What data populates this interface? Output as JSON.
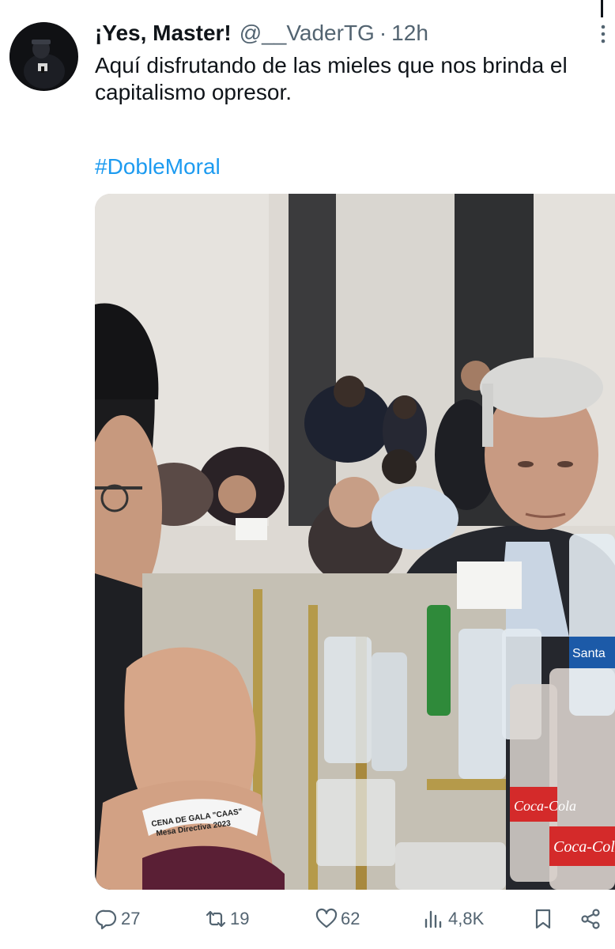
{
  "tweet": {
    "display_name": "¡Yes, Master!",
    "handle": "@__VaderTG",
    "separator": "·",
    "timestamp": "12h",
    "text": "Aquí disfrutando de las mieles que nos brinda el capitalismo opresor.",
    "hashtag": "#DobleMoral"
  },
  "media": {
    "wristband_line1": "CENA DE GALA \"CAAS\"",
    "wristband_line2": "Mesa Directiva 2023",
    "bottle_label": "Coca-Cola",
    "water_label": "Santa"
  },
  "actions": {
    "replies": "27",
    "retweets": "19",
    "likes": "62",
    "views": "4,8K"
  },
  "icons": {
    "reply": "reply-icon",
    "retweet": "retweet-icon",
    "like": "heart-icon",
    "views": "views-icon",
    "bookmark": "bookmark-icon",
    "share": "share-icon",
    "more": "more-vertical-icon"
  },
  "colors": {
    "text": "#0f1419",
    "muted": "#536471",
    "link": "#1d9bf0"
  }
}
